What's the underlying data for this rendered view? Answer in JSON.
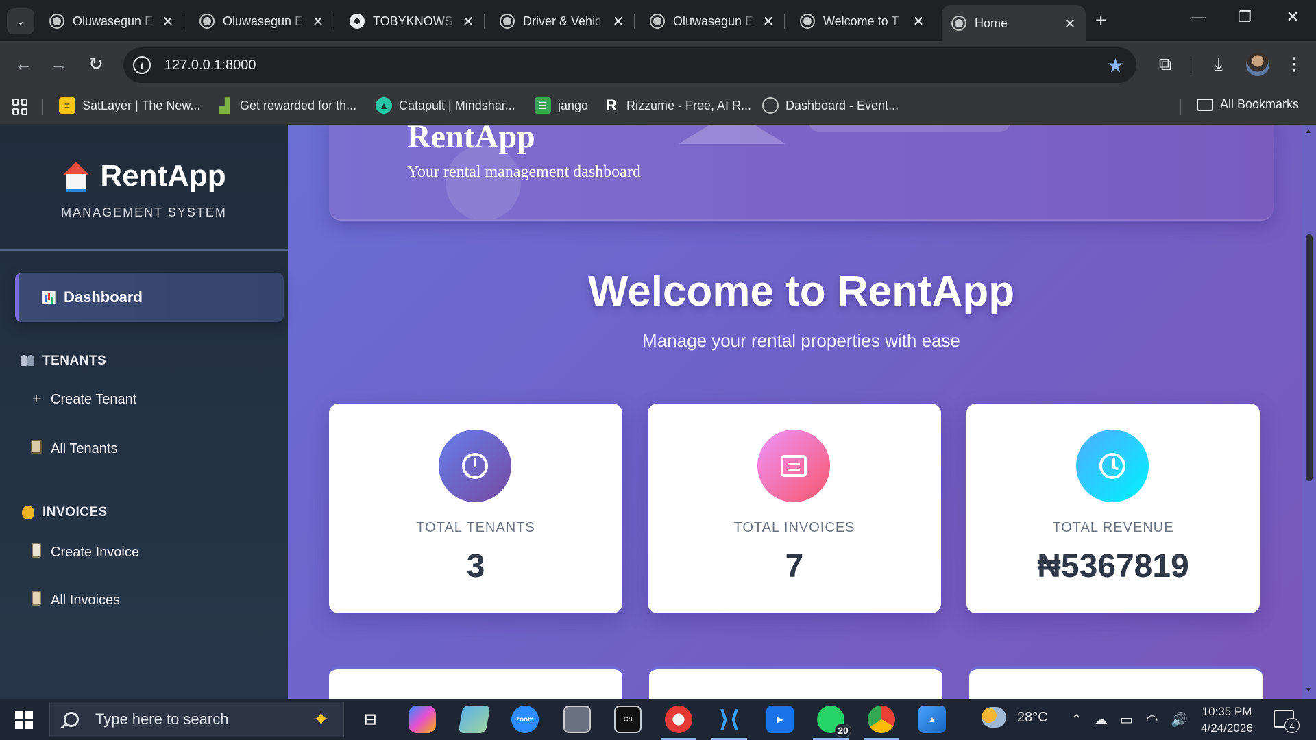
{
  "browser": {
    "tabs": [
      {
        "label": "Oluwasegun E",
        "icon": "globe-icon"
      },
      {
        "label": "Oluwasegun E",
        "icon": "globe-icon"
      },
      {
        "label": "TOBYKNOWS",
        "icon": "github-icon"
      },
      {
        "label": "Driver & Vehic",
        "icon": "globe-icon"
      },
      {
        "label": "Oluwasegun E",
        "icon": "globe-icon"
      },
      {
        "label": "Welcome to T",
        "icon": "globe-icon"
      },
      {
        "label": "Home",
        "icon": "globe-icon",
        "active": true
      }
    ],
    "url": "127.0.0.1:8000",
    "bookmarks": [
      {
        "label": "SatLayer | The New...",
        "icon": "satlayer-icon",
        "color": "#f5c518"
      },
      {
        "label": "Get rewarded for th...",
        "icon": "chart-up-icon",
        "color": "#7cb342"
      },
      {
        "label": "Catapult | Mindshar...",
        "icon": "catapult-icon",
        "color": "#26c6a6"
      },
      {
        "label": "jango",
        "icon": "document-icon",
        "color": "#34a853"
      },
      {
        "label": "Rizzume - Free, AI R...",
        "icon": "rizzume-icon",
        "color": "#ffffff"
      },
      {
        "label": "Dashboard - Event...",
        "icon": "globe-icon",
        "color": "#c4c7c5"
      }
    ],
    "all_bookmarks": "All Bookmarks"
  },
  "sidebar": {
    "brand_title": "RentApp",
    "brand_subtitle": "MANAGEMENT SYSTEM",
    "active_item": "Dashboard",
    "sections": [
      {
        "title": "TENANTS",
        "items": [
          "Create Tenant",
          "All Tenants"
        ]
      },
      {
        "title": "INVOICES",
        "items": [
          "Create Invoice",
          "All Invoices"
        ]
      }
    ]
  },
  "main": {
    "hero_title": "RentApp",
    "hero_subtitle": "Your rental management dashboard",
    "welcome_title": "Welcome to RentApp",
    "welcome_subtitle": "Manage your rental properties with ease",
    "stats": [
      {
        "label": "TOTAL TENANTS",
        "value": "3",
        "icon": "power-icon",
        "color_from": "#667eea",
        "color_to": "#764ba2"
      },
      {
        "label": "TOTAL INVOICES",
        "value": "7",
        "icon": "invoice-icon",
        "color_from": "#f093fb",
        "color_to": "#f5576c"
      },
      {
        "label": "TOTAL REVENUE",
        "value": "₦5367819",
        "icon": "clock-icon",
        "color_from": "#4facfe",
        "color_to": "#00f2fe"
      }
    ]
  },
  "taskbar": {
    "search_placeholder": "Type here to search",
    "whatsapp_badge": "20",
    "weather": "28°C",
    "time": "10:35 PM",
    "date": "4/24/2026",
    "notifications": "4"
  }
}
